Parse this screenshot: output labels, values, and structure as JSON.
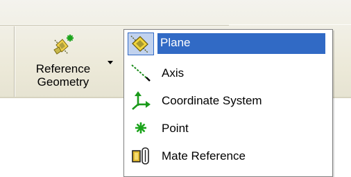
{
  "toolbar": {
    "reference_geometry_label_line1": "Reference",
    "reference_geometry_label_line2": "Geometry"
  },
  "menu": {
    "items": [
      {
        "label": "Plane",
        "icon": "plane-icon",
        "selected": true
      },
      {
        "label": "Axis",
        "icon": "axis-icon",
        "selected": false
      },
      {
        "label": "Coordinate System",
        "icon": "coordinate-system-icon",
        "selected": false
      },
      {
        "label": "Point",
        "icon": "point-icon",
        "selected": false
      },
      {
        "label": "Mate Reference",
        "icon": "mate-reference-icon",
        "selected": false
      }
    ]
  },
  "colors": {
    "selection_blue": "#316ac5",
    "toolbar_bg": "#ece9d8"
  }
}
